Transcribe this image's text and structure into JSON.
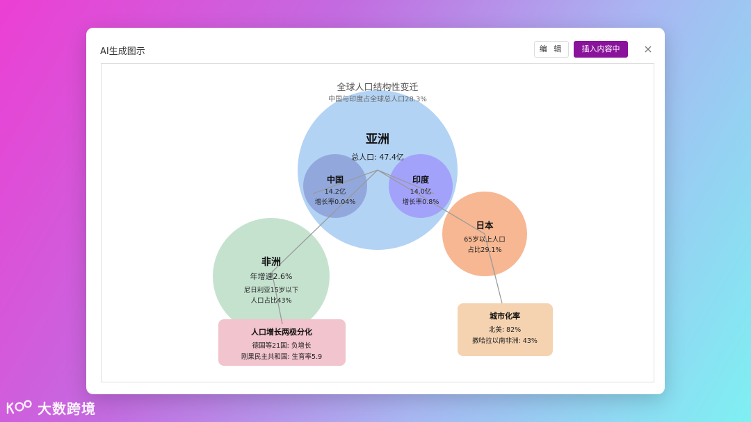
{
  "dialog": {
    "title": "AI生成图示",
    "edit_label": "编 辑",
    "insert_label": "插入内容中",
    "close_symbol": "×"
  },
  "diagram": {
    "title": "全球人口结构性变迁",
    "subtitle": "中国与印度占全球总人口28.3%",
    "asia": {
      "name": "亚洲",
      "detail": "总人口: 47.4亿"
    },
    "china": {
      "name": "中国",
      "line1": "14.2亿",
      "line2": "增长率0.04%"
    },
    "india": {
      "name": "印度",
      "line1": "14.0亿",
      "line2": "增长率0.8%"
    },
    "japan": {
      "name": "日本",
      "line1": "65岁以上人口",
      "line2": "占比29.1%"
    },
    "africa": {
      "name": "非洲",
      "line1": "年增速2.6%",
      "line2": "尼日利亚15岁以下",
      "line3": "人口占比43%"
    },
    "polarization": {
      "name": "人口增长两极分化",
      "line1": "德国等21国: 负增长",
      "line2": "刚果民主共和国: 生育率5.9"
    },
    "urbanization": {
      "name": "城市化率",
      "line1": "北美: 82%",
      "line2": "撒哈拉以南非洲: 43%"
    }
  },
  "colors": {
    "asia": "#b3d3f4",
    "china": "#92a8dc",
    "india": "#a3a2fa",
    "japan": "#f6b792",
    "africa": "#c5e2cf",
    "polarization": "#f2c4cd",
    "urbanization": "#f5d3b1",
    "accent": "#8a139b"
  },
  "watermark": {
    "text": "大数跨境"
  }
}
